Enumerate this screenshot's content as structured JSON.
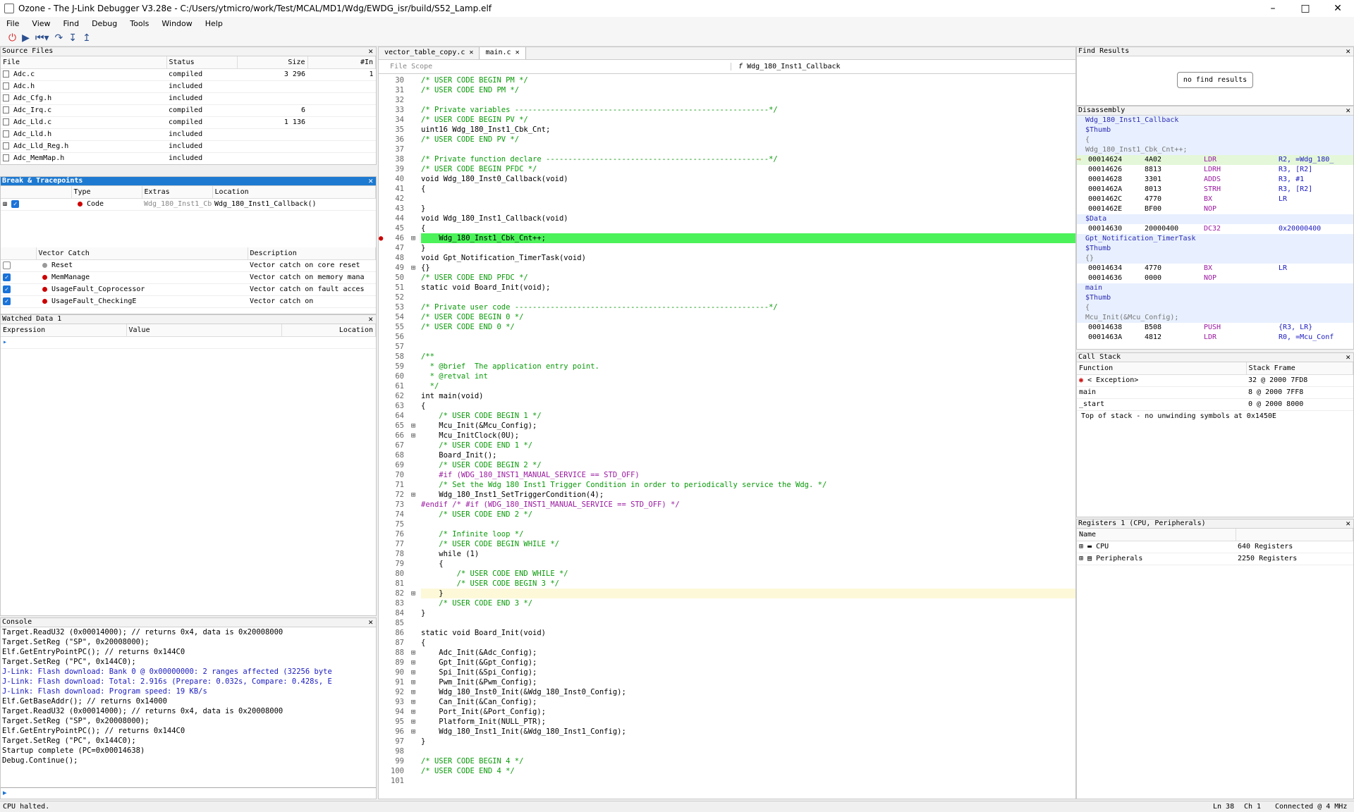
{
  "window": {
    "title": "Ozone - The J-Link Debugger V3.28e - C:/Users/ytmicro/work/Test/MCAL/MD1/Wdg/EWDG_isr/build/S52_Lamp.elf"
  },
  "menu": [
    "File",
    "View",
    "Find",
    "Debug",
    "Tools",
    "Window",
    "Help"
  ],
  "source_files": {
    "title": "Source Files",
    "columns": [
      "File",
      "Status",
      "Size",
      "#In"
    ],
    "rows": [
      [
        "Adc.c",
        "compiled",
        "3 296",
        "1"
      ],
      [
        "Adc.h",
        "included",
        "",
        ""
      ],
      [
        "Adc_Cfg.h",
        "included",
        "",
        ""
      ],
      [
        "Adc_Irq.c",
        "compiled",
        "6",
        ""
      ],
      [
        "Adc_Lld.c",
        "compiled",
        "1 136",
        ""
      ],
      [
        "Adc_Lld.h",
        "included",
        "",
        ""
      ],
      [
        "Adc_Lld_Reg.h",
        "included",
        "",
        ""
      ],
      [
        "Adc_MemMap.h",
        "included",
        "",
        ""
      ]
    ]
  },
  "breakpoints": {
    "title": "Break & Tracepoints",
    "columns": [
      "Type",
      "Extras",
      "Location"
    ],
    "rows": [
      {
        "type": "Code",
        "extras": "Wdg_180_Inst1_Cb",
        "location": "Wdg_180_Inst1_Callback()"
      }
    ]
  },
  "vector_catch": {
    "columns": [
      "Vector Catch",
      "Description"
    ],
    "rows": [
      {
        "name": "Reset",
        "desc": "Vector catch on core reset"
      },
      {
        "name": "MemManage",
        "desc": "Vector catch on memory mana"
      },
      {
        "name": "UsageFault_Coprocessor",
        "desc": "Vector catch on fault acces"
      },
      {
        "name": "UsageFault_CheckingE",
        "desc": "Vector catch on "
      }
    ]
  },
  "watched": {
    "title": "Watched Data 1",
    "columns": [
      "Expression",
      "Value",
      "Location"
    ]
  },
  "console": {
    "title": "Console",
    "lines": [
      "Target.ReadU32 (0x00014000); // returns 0x4, data is 0x20008000",
      "Target.SetReg (\"SP\", 0x20008000);",
      "Elf.GetEntryPointPC(); // returns 0x144C0",
      "Target.SetReg (\"PC\", 0x144C0);",
      "J-Link: Flash download: Bank 0 @ 0x00000000: 2 ranges affected (32256 byte",
      "J-Link: Flash download: Total: 2.916s (Prepare: 0.032s, Compare: 0.428s, E",
      "J-Link: Flash download: Program speed: 19 KB/s",
      "Elf.GetBaseAddr(); // returns 0x14000",
      "Target.ReadU32 (0x00014000); // returns 0x4, data is 0x20008000",
      "Target.SetReg (\"SP\", 0x20008000);",
      "Elf.GetEntryPointPC(); // returns 0x144C0",
      "Target.SetReg (\"PC\", 0x144C0);",
      "Startup complete (PC=0x00014638)",
      "Debug.Continue();"
    ]
  },
  "editor": {
    "tabs": [
      "vector_table_copy.c",
      "main.c"
    ],
    "scope": "File Scope",
    "function": "Wdg_180_Inst1_Callback",
    "lines": [
      [
        30,
        "/* USER CODE BEGIN PM */"
      ],
      [
        31,
        "/* USER CODE END PM */"
      ],
      [
        32,
        ""
      ],
      [
        33,
        "/* Private variables ---------------------------------------------------------*/"
      ],
      [
        34,
        "/* USER CODE BEGIN PV */"
      ],
      [
        35,
        "uint16 Wdg_180_Inst1_Cbk_Cnt;"
      ],
      [
        36,
        "/* USER CODE END PV */"
      ],
      [
        37,
        ""
      ],
      [
        38,
        "/* Private function declare --------------------------------------------------*/"
      ],
      [
        39,
        "/* USER CODE BEGIN PFDC */"
      ],
      [
        40,
        "void Wdg_180_Inst0_Callback(void)"
      ],
      [
        41,
        "{"
      ],
      [
        42,
        ""
      ],
      [
        43,
        "}"
      ],
      [
        44,
        "void Wdg_180_Inst1_Callback(void)"
      ],
      [
        45,
        "{"
      ],
      [
        46,
        "    Wdg_180_Inst1_Cbk_Cnt++;"
      ],
      [
        47,
        "}"
      ],
      [
        48,
        "void Gpt_Notification_TimerTask(void)"
      ],
      [
        49,
        "{}"
      ],
      [
        50,
        "/* USER CODE END PFDC */"
      ],
      [
        51,
        "static void Board_Init(void);"
      ],
      [
        52,
        ""
      ],
      [
        53,
        "/* Private user code ---------------------------------------------------------*/"
      ],
      [
        54,
        "/* USER CODE BEGIN 0 */"
      ],
      [
        55,
        "/* USER CODE END 0 */"
      ],
      [
        56,
        ""
      ],
      [
        57,
        ""
      ],
      [
        58,
        "/**"
      ],
      [
        59,
        "  * @brief  The application entry point."
      ],
      [
        60,
        "  * @retval int"
      ],
      [
        61,
        "  */"
      ],
      [
        62,
        "int main(void)"
      ],
      [
        63,
        "{"
      ],
      [
        64,
        "    /* USER CODE BEGIN 1 */"
      ],
      [
        65,
        "    Mcu_Init(&Mcu_Config);"
      ],
      [
        66,
        "    Mcu_InitClock(0U);"
      ],
      [
        67,
        "    /* USER CODE END 1 */"
      ],
      [
        68,
        "    Board_Init();"
      ],
      [
        69,
        "    /* USER CODE BEGIN 2 */"
      ],
      [
        70,
        "    #if (WDG_180_INST1_MANUAL_SERVICE == STD_OFF)"
      ],
      [
        71,
        "    /* Set the Wdg 180 Inst1 Trigger Condition in order to periodically service the Wdg. */"
      ],
      [
        72,
        "    Wdg_180_Inst1_SetTriggerCondition(4);"
      ],
      [
        73,
        "#endif /* #if (WDG_180_INST1_MANUAL_SERVICE == STD_OFF) */"
      ],
      [
        74,
        "    /* USER CODE END 2 */"
      ],
      [
        75,
        ""
      ],
      [
        76,
        "    /* Infinite loop */"
      ],
      [
        77,
        "    /* USER CODE BEGIN WHILE */"
      ],
      [
        78,
        "    while (1)"
      ],
      [
        79,
        "    {"
      ],
      [
        80,
        "        /* USER CODE END WHILE */"
      ],
      [
        81,
        "        /* USER CODE BEGIN 3 */"
      ],
      [
        82,
        "    }"
      ],
      [
        83,
        "    /* USER CODE END 3 */"
      ],
      [
        84,
        "}"
      ],
      [
        85,
        ""
      ],
      [
        86,
        "static void Board_Init(void)"
      ],
      [
        87,
        "{"
      ],
      [
        88,
        "    Adc_Init(&Adc_Config);"
      ],
      [
        89,
        "    Gpt_Init(&Gpt_Config);"
      ],
      [
        90,
        "    Spi_Init(&Spi_Config);"
      ],
      [
        91,
        "    Pwm_Init(&Pwm_Config);"
      ],
      [
        92,
        "    Wdg_180_Inst0_Init(&Wdg_180_Inst0_Config);"
      ],
      [
        93,
        "    Can_Init(&Can_Config);"
      ],
      [
        94,
        "    Port_Init(&Port_Config);"
      ],
      [
        95,
        "    Platform_Init(NULL_PTR);"
      ],
      [
        96,
        "    Wdg_180_Inst1_Init(&Wdg_180_Inst1_Config);"
      ],
      [
        97,
        "}"
      ],
      [
        98,
        ""
      ],
      [
        99,
        "/* USER CODE BEGIN 4 */"
      ],
      [
        100,
        "/* USER CODE END 4 */"
      ],
      [
        101,
        ""
      ]
    ]
  },
  "find": {
    "title": "Find Results",
    "button": "no find results"
  },
  "disasm": {
    "title": "Disassembly",
    "lines": [
      {
        "k": "sym",
        "t": "Wdg_180_Inst1_Callback"
      },
      {
        "k": "sym",
        "t": "$Thumb"
      },
      {
        "k": "src",
        "t": "{"
      },
      {
        "k": "src",
        "t": "Wdg_180_Inst1_Cbk_Cnt++;"
      },
      {
        "k": "ins",
        "a": "00014624",
        "o": "4A02",
        "m": "LDR",
        "r": "R2, =Wdg_180_"
      },
      {
        "k": "ins",
        "a": "00014626",
        "o": "8813",
        "m": "LDRH",
        "r": "R3, [R2]"
      },
      {
        "k": "ins",
        "a": "00014628",
        "o": "3301",
        "m": "ADDS",
        "r": "R3, #1"
      },
      {
        "k": "ins",
        "a": "0001462A",
        "o": "8013",
        "m": "STRH",
        "r": "R3, [R2]"
      },
      {
        "k": "ins",
        "a": "0001462C",
        "o": "4770",
        "m": "BX",
        "r": "LR"
      },
      {
        "k": "ins",
        "a": "0001462E",
        "o": "BF00",
        "m": "NOP",
        "r": ""
      },
      {
        "k": "sym",
        "t": "$Data"
      },
      {
        "k": "ins",
        "a": "00014630",
        "o": "20000400",
        "m": "DC32",
        "r": "0x20000400"
      },
      {
        "k": "sym",
        "t": "Gpt_Notification_TimerTask"
      },
      {
        "k": "sym",
        "t": "$Thumb"
      },
      {
        "k": "src",
        "t": "{}"
      },
      {
        "k": "ins",
        "a": "00014634",
        "o": "4770",
        "m": "BX",
        "r": "LR"
      },
      {
        "k": "ins",
        "a": "00014636",
        "o": "0000",
        "m": "NOP",
        "r": ""
      },
      {
        "k": "sym",
        "t": "main"
      },
      {
        "k": "sym",
        "t": "$Thumb"
      },
      {
        "k": "src",
        "t": "{"
      },
      {
        "k": "src",
        "t": "Mcu_Init(&Mcu_Config);"
      },
      {
        "k": "ins",
        "a": "00014638",
        "o": "B508",
        "m": "PUSH",
        "r": "{R3, LR}"
      },
      {
        "k": "ins",
        "a": "0001463A",
        "o": "4812",
        "m": "LDR",
        "r": "R0, =Mcu_Conf"
      }
    ]
  },
  "callstack": {
    "title": "Call Stack",
    "columns": [
      "Function",
      "Stack Frame"
    ],
    "rows": [
      [
        "< Exception>",
        "32 @ 2000 7FD8"
      ],
      [
        "main",
        "8 @ 2000 7FF8"
      ],
      [
        "_start",
        "0 @ 2000 8000"
      ]
    ],
    "note": "Top of stack - no unwinding symbols at 0x1450E"
  },
  "registers": {
    "title": "Registers 1 (CPU, Peripherals)",
    "columns": [
      "Name"
    ],
    "rows": [
      [
        "CPU",
        "640 Registers"
      ],
      [
        "Peripherals",
        "2250 Registers"
      ]
    ]
  },
  "status": {
    "left": "CPU halted.",
    "ln": "Ln 38",
    "ch": "Ch 1",
    "conn": "Connected @ 4 MHz"
  }
}
